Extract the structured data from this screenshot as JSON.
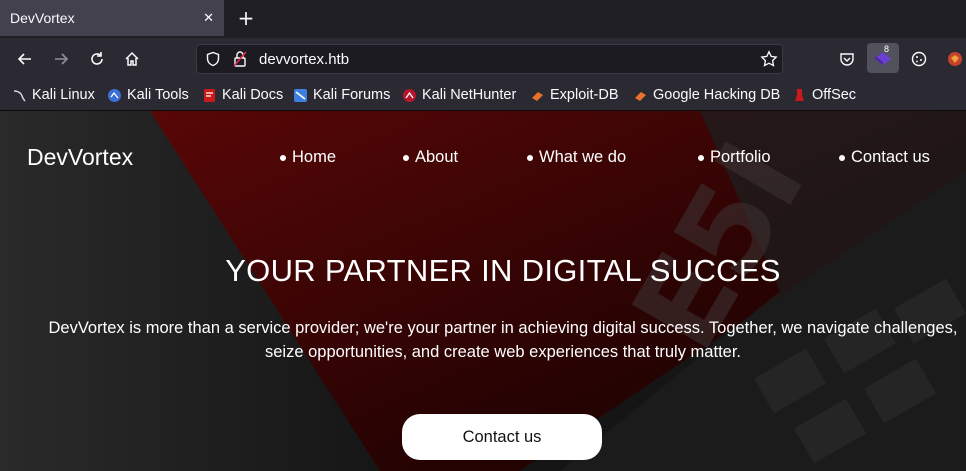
{
  "tab": {
    "title": "DevVortex",
    "close_glyph": "✕",
    "new_tab_glyph": "+"
  },
  "toolbar": {
    "url": "devvortex.htb",
    "icons": [
      "back-icon",
      "forward-icon",
      "reload-icon",
      "home-icon",
      "shield-icon",
      "lock-icon",
      "bookmark-star-icon",
      "pocket-icon",
      "extension-icon",
      "cookie-icon",
      "fox-icon"
    ],
    "extension_badge_count": "8"
  },
  "bookmarks": [
    {
      "label": "Kali Linux",
      "icon": "kali-dragon-icon"
    },
    {
      "label": "Kali Tools",
      "icon": "kali-tools-icon"
    },
    {
      "label": "Kali Docs",
      "icon": "kali-docs-icon"
    },
    {
      "label": "Kali Forums",
      "icon": "kali-forums-icon"
    },
    {
      "label": "Kali NetHunter",
      "icon": "nethunter-icon"
    },
    {
      "label": "Exploit-DB",
      "icon": "exploit-db-icon"
    },
    {
      "label": "Google Hacking DB",
      "icon": "ghdb-icon"
    },
    {
      "label": "OffSec",
      "icon": "offsec-icon"
    }
  ],
  "site": {
    "brand": "DevVortex",
    "menu": [
      "Home",
      "About",
      "What we do",
      "Portfolio",
      "Contact us"
    ],
    "hero_title": "YOUR PARTNER IN DIGITAL SUCCES",
    "hero_text": "DevVortex is more than a service provider; we're your partner in achieving digital success. Together, we navigate challenges, seize opportunities, and create web experiences that truly matter.",
    "cta_label": "Contact us"
  },
  "colors": {
    "accent_red": "#7a0a0a",
    "chrome_dark": "#2b2a33",
    "tab_active": "#42414d"
  }
}
